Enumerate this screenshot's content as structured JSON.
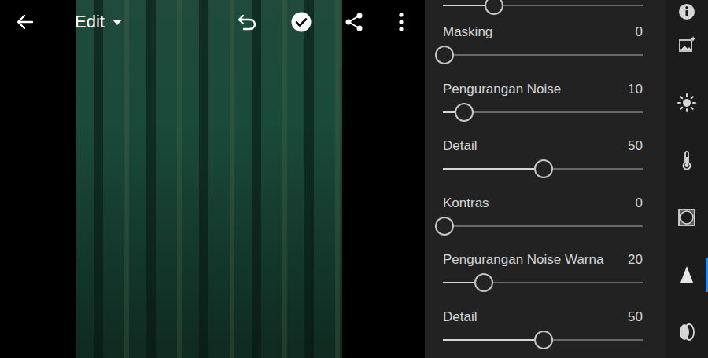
{
  "top_bar": {
    "title": "Edit"
  },
  "panel": {
    "scrolled_slider": {
      "level": 0.25
    },
    "sliders": [
      {
        "label": "Masking",
        "value": "0",
        "level": 0
      },
      {
        "label": "Pengurangan Noise",
        "value": "10",
        "level": 0.1
      },
      {
        "label": "Detail",
        "value": "50",
        "level": 0.5
      },
      {
        "label": "Kontras",
        "value": "0",
        "level": 0
      },
      {
        "label": "Pengurangan Noise Warna",
        "value": "20",
        "level": 0.2
      },
      {
        "label": "Detail",
        "value": "50",
        "level": 0.5
      }
    ]
  },
  "tools": [
    {
      "selected": false
    },
    {
      "selected": false
    },
    {
      "selected": false
    },
    {
      "selected": false
    },
    {
      "selected": false
    },
    {
      "selected": true
    },
    {
      "selected": false
    }
  ]
}
